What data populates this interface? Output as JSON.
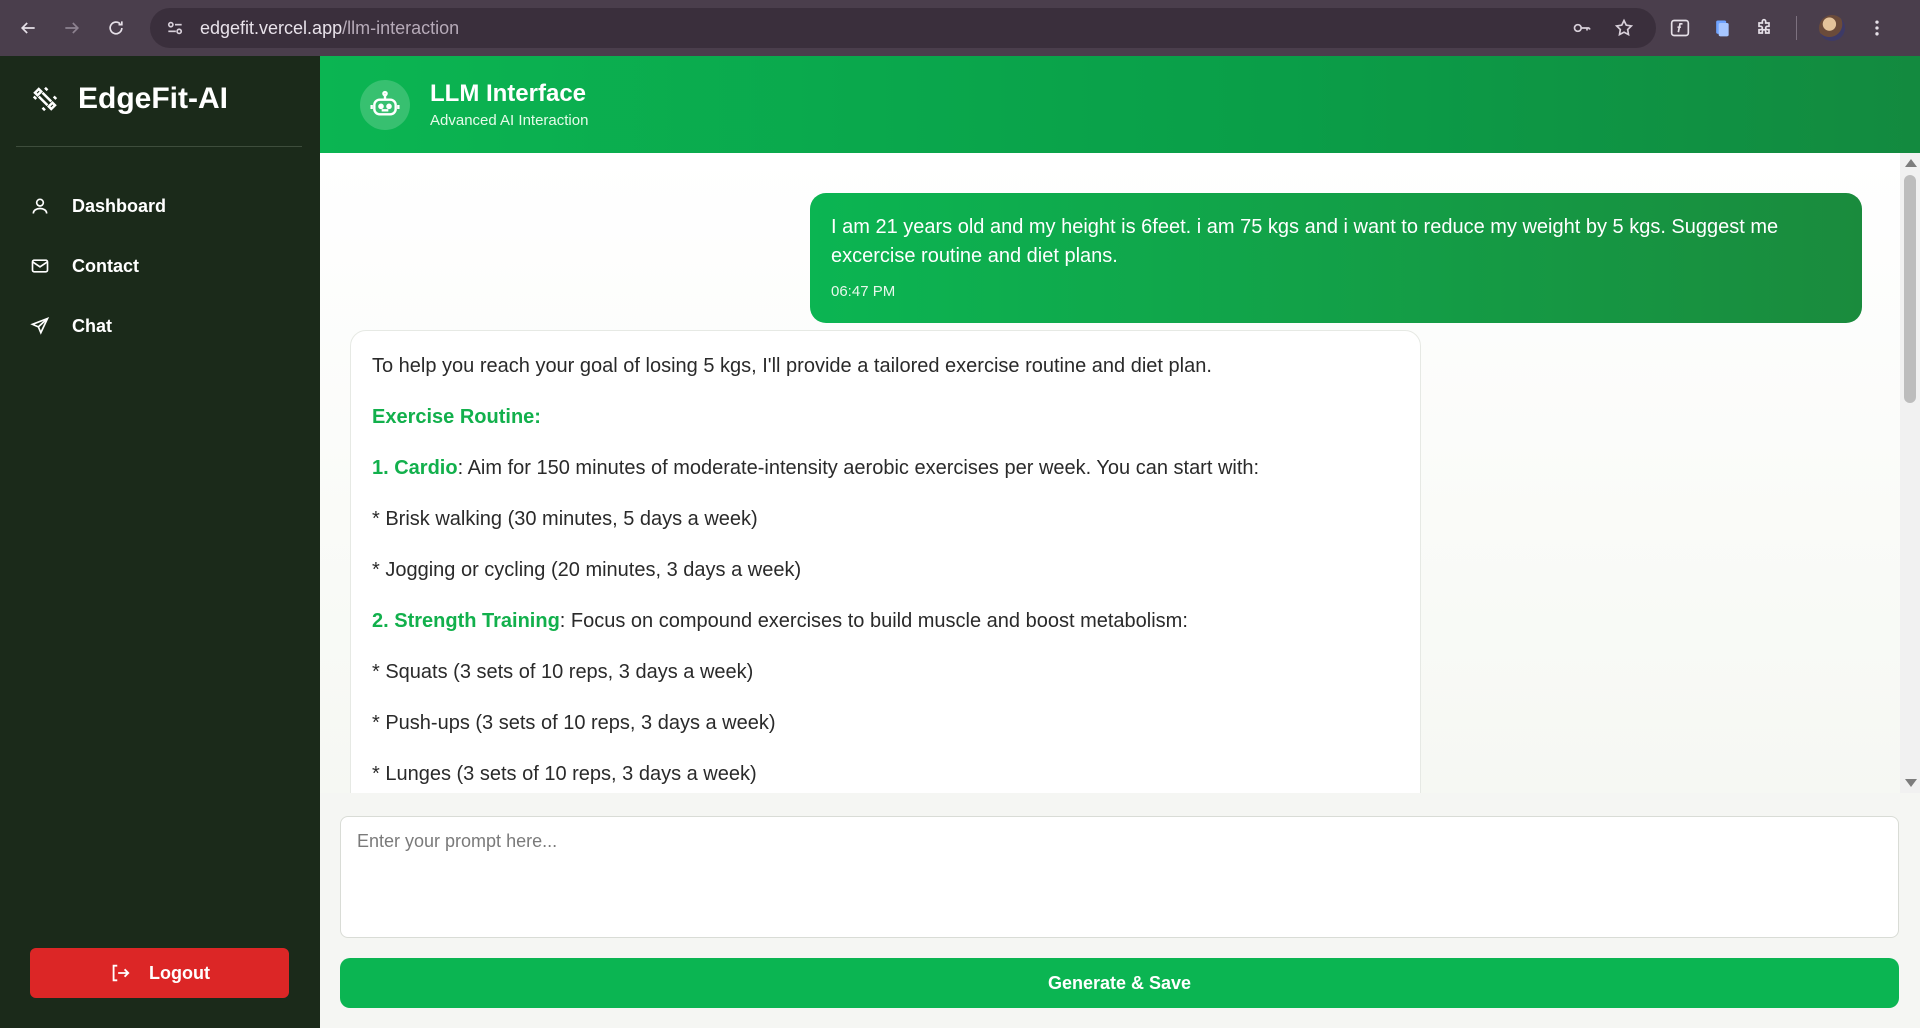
{
  "browser": {
    "url_host": "edgefit.vercel.app",
    "url_path": "/llm-interaction"
  },
  "sidebar": {
    "brand": "EdgeFit-AI",
    "items": [
      {
        "label": "Dashboard",
        "icon": "user-icon"
      },
      {
        "label": "Contact",
        "icon": "mail-icon"
      },
      {
        "label": "Chat",
        "icon": "send-icon"
      }
    ],
    "logout_label": "Logout"
  },
  "header": {
    "title": "LLM Interface",
    "subtitle": "Advanced AI Interaction"
  },
  "chat": {
    "user_message": {
      "text": "I am 21 years old and my height is 6feet. i am 75 kgs and i want to reduce my weight by 5 kgs. Suggest me excercise routine and diet plans.",
      "time": "06:47 PM"
    },
    "ai_message": {
      "intro": "To help you reach your goal of losing 5 kgs, I'll provide a tailored exercise routine and diet plan.",
      "section_title": "Exercise Routine:",
      "item1_label": "1.  Cardio",
      "item1_text": ": Aim for 150 minutes of moderate-intensity aerobic exercises per week. You can start with:",
      "item1_bullets": [
        "* Brisk walking (30 minutes, 5 days a week)",
        "* Jogging or cycling (20 minutes, 3 days a week)"
      ],
      "item2_label": "2.  Strength Training",
      "item2_text": ": Focus on compound exercises to build muscle and boost metabolism:",
      "item2_bullets": [
        "* Squats (3 sets of 10 reps, 3 days a week)",
        "* Push-ups (3 sets of 10 reps, 3 days a week)",
        "* Lunges (3 sets of 10 reps, 3 days a week)"
      ]
    }
  },
  "composer": {
    "placeholder": "Enter your prompt here...",
    "value": "",
    "submit_label": "Generate & Save"
  },
  "colors": {
    "accent": "#0bb552",
    "sidebar_bg": "#1b2a1a",
    "logout": "#dc2626"
  }
}
